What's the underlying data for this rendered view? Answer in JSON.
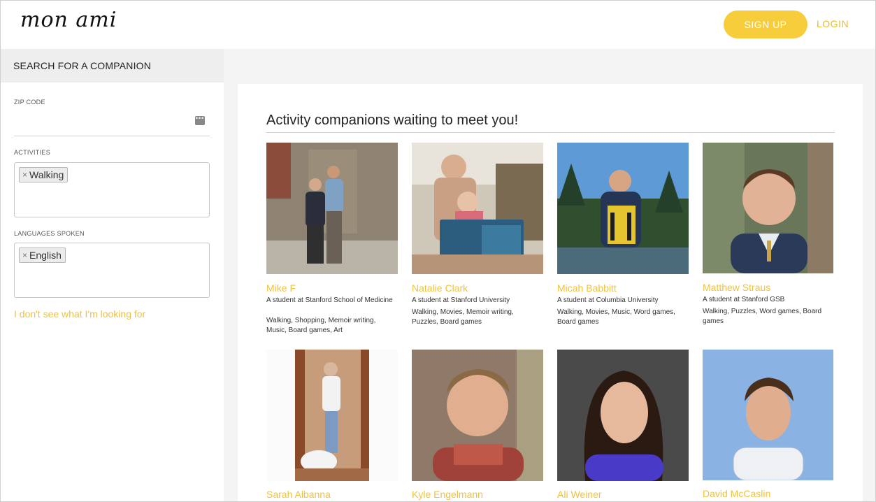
{
  "header": {
    "logo": "mon ami",
    "signup_label": "SIGN UP",
    "login_label": "LOGIN"
  },
  "sidebar": {
    "title": "SEARCH FOR A COMPANION",
    "zip_label": "ZIP CODE",
    "zip_value": "",
    "activities_label": "ACTIVITIES",
    "activities": [
      "Walking"
    ],
    "languages_label": "LANGUAGES SPOKEN",
    "languages": [
      "English"
    ],
    "tag_remove": "×",
    "not_found_link": "I don't see what I'm looking for"
  },
  "main": {
    "title": "Activity companions waiting to meet you!",
    "companions": [
      {
        "name": "Mike F",
        "description": "A student at Stanford School of Medicine",
        "activities": "Walking, Shopping, Memoir writing, Music, Board games, Art"
      },
      {
        "name": "Natalie Clark",
        "description": "A student at Stanford University",
        "activities": "Walking, Movies, Memoir writing, Puzzles, Board games"
      },
      {
        "name": "Micah Babbitt",
        "description": "A student at Columbia University",
        "activities": "Walking, Movies, Music, Word games, Board games"
      },
      {
        "name": "Matthew Straus",
        "description": "A student at Stanford GSB",
        "activities": "Walking, Puzzles, Word games, Board games"
      },
      {
        "name": "Sarah Albanna"
      },
      {
        "name": "Kyle Engelmann"
      },
      {
        "name": "Ali Weiner"
      },
      {
        "name": "David McCaslin"
      }
    ]
  },
  "colors": {
    "accent": "#f7cd3c",
    "link": "#f0c33c"
  }
}
